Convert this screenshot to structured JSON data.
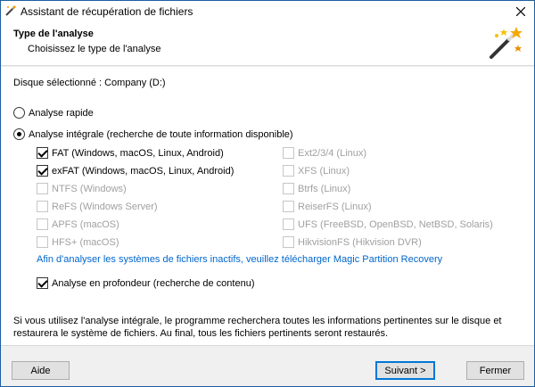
{
  "window": {
    "title": "Assistant de récupération de fichiers"
  },
  "header": {
    "title": "Type de l'analyse",
    "subtitle": "Choisissez le type de l'analyse"
  },
  "disk": {
    "label": "Disque sélectionné : Company (D:)"
  },
  "scan_options": {
    "quick": {
      "label": "Analyse rapide",
      "selected": false
    },
    "full": {
      "label": "Analyse intégrale (recherche de toute information disponible)",
      "selected": true
    }
  },
  "filesystems_left": [
    {
      "label": "FAT (Windows, macOS, Linux, Android)",
      "checked": true,
      "enabled": true
    },
    {
      "label": "exFAT (Windows, macOS, Linux, Android)",
      "checked": true,
      "enabled": true
    },
    {
      "label": "NTFS (Windows)",
      "checked": false,
      "enabled": false
    },
    {
      "label": "ReFS (Windows Server)",
      "checked": false,
      "enabled": false
    },
    {
      "label": "APFS (macOS)",
      "checked": false,
      "enabled": false
    },
    {
      "label": "HFS+ (macOS)",
      "checked": false,
      "enabled": false
    }
  ],
  "filesystems_right": [
    {
      "label": "Ext2/3/4 (Linux)",
      "checked": false,
      "enabled": false
    },
    {
      "label": "XFS (Linux)",
      "checked": false,
      "enabled": false
    },
    {
      "label": "Btrfs (Linux)",
      "checked": false,
      "enabled": false
    },
    {
      "label": "ReiserFS (Linux)",
      "checked": false,
      "enabled": false
    },
    {
      "label": "UFS (FreeBSD, OpenBSD, NetBSD, Solaris)",
      "checked": false,
      "enabled": false
    },
    {
      "label": "HikvisionFS (Hikvision DVR)",
      "checked": false,
      "enabled": false
    }
  ],
  "link": {
    "text": "Afin d'analyser les systèmes de fichiers inactifs, veuillez télécharger Magic Partition Recovery"
  },
  "deep_scan": {
    "label": "Analyse en profondeur (recherche de contenu)",
    "checked": true
  },
  "info": {
    "text": "Si vous utilisez l'analyse intégrale, le programme recherchera toutes les informations pertinentes sur le disque et restaurera le système de fichiers. Au final, tous les fichiers pertinents seront restaurés."
  },
  "footer": {
    "help_label": "Aide",
    "next_label": "Suivant >",
    "close_label": "Fermer"
  },
  "colors": {
    "link": "#0066cc",
    "accent": "#0078d7",
    "disabled_text": "#a0a0a0"
  },
  "icons": {
    "app": "app-icon",
    "close": "close-icon",
    "header": "magic-wand-icon"
  }
}
